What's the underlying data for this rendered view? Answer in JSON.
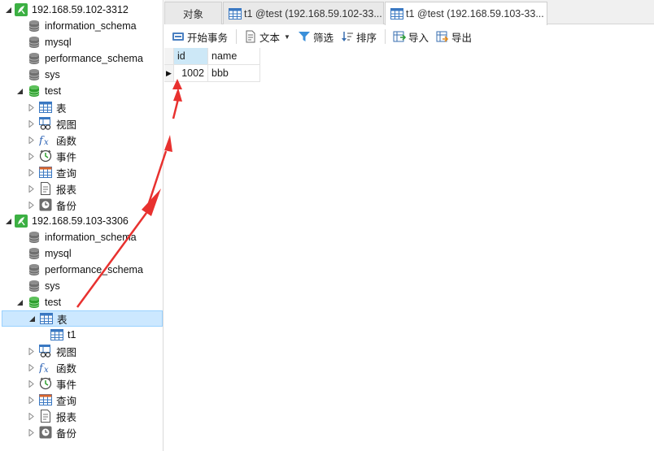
{
  "tree": [
    {
      "label": "192.168.59.102-3312",
      "icon": "connection-icon",
      "level": 0,
      "twisty": "expanded"
    },
    {
      "label": "information_schema",
      "icon": "database-icon",
      "level": 1,
      "twisty": "none"
    },
    {
      "label": "mysql",
      "icon": "database-icon",
      "level": 1,
      "twisty": "none"
    },
    {
      "label": "performance_schema",
      "icon": "database-icon",
      "level": 1,
      "twisty": "none"
    },
    {
      "label": "sys",
      "icon": "database-icon",
      "level": 1,
      "twisty": "none"
    },
    {
      "label": "test",
      "icon": "database-open-icon",
      "level": 1,
      "twisty": "expanded"
    },
    {
      "label": "表",
      "icon": "table-icon",
      "level": 2,
      "twisty": "collapsed"
    },
    {
      "label": "视图",
      "icon": "view-icon",
      "level": 2,
      "twisty": "collapsed"
    },
    {
      "label": "函数",
      "icon": "function-icon",
      "level": 2,
      "twisty": "collapsed"
    },
    {
      "label": "事件",
      "icon": "event-icon",
      "level": 2,
      "twisty": "collapsed"
    },
    {
      "label": "查询",
      "icon": "query-icon",
      "level": 2,
      "twisty": "collapsed"
    },
    {
      "label": "报表",
      "icon": "report-icon",
      "level": 2,
      "twisty": "collapsed"
    },
    {
      "label": "备份",
      "icon": "backup-icon",
      "level": 2,
      "twisty": "collapsed"
    },
    {
      "label": "192.168.59.103-3306",
      "icon": "connection-icon",
      "level": 0,
      "twisty": "expanded"
    },
    {
      "label": "information_schema",
      "icon": "database-icon",
      "level": 1,
      "twisty": "none"
    },
    {
      "label": "mysql",
      "icon": "database-icon",
      "level": 1,
      "twisty": "none"
    },
    {
      "label": "performance_schema",
      "icon": "database-icon",
      "level": 1,
      "twisty": "none"
    },
    {
      "label": "sys",
      "icon": "database-icon",
      "level": 1,
      "twisty": "none"
    },
    {
      "label": "test",
      "icon": "database-open-icon",
      "level": 1,
      "twisty": "expanded"
    },
    {
      "label": "表",
      "icon": "table-icon",
      "level": 2,
      "twisty": "expanded",
      "selected": true
    },
    {
      "label": "t1",
      "icon": "table-icon",
      "level": 3,
      "twisty": "none"
    },
    {
      "label": "视图",
      "icon": "view-icon",
      "level": 2,
      "twisty": "collapsed"
    },
    {
      "label": "函数",
      "icon": "function-icon",
      "level": 2,
      "twisty": "collapsed"
    },
    {
      "label": "事件",
      "icon": "event-icon",
      "level": 2,
      "twisty": "collapsed"
    },
    {
      "label": "查询",
      "icon": "query-icon",
      "level": 2,
      "twisty": "collapsed"
    },
    {
      "label": "报表",
      "icon": "report-icon",
      "level": 2,
      "twisty": "collapsed"
    },
    {
      "label": "备份",
      "icon": "backup-icon",
      "level": 2,
      "twisty": "collapsed"
    }
  ],
  "tabs": [
    {
      "label": "对象",
      "active": false,
      "icon": ""
    },
    {
      "label": "t1 @test (192.168.59.102-33...",
      "active": false,
      "icon": "table-icon"
    },
    {
      "label": "t1 @test (192.168.59.103-33...",
      "active": true,
      "icon": "table-icon"
    }
  ],
  "toolbar": {
    "begin_transaction": "开始事务",
    "text": "文本",
    "filter": "筛选",
    "sort": "排序",
    "import": "导入",
    "export": "导出"
  },
  "grid": {
    "columns": [
      "id",
      "name"
    ],
    "rows": [
      [
        "1002",
        "bbb"
      ]
    ]
  },
  "colors": {
    "selection": "#cce8ff",
    "selection_border": "#99d1ff",
    "annotation_arrow": "#e8312f",
    "connection_green": "#3cb043",
    "header_highlight": "#cde8f7"
  }
}
